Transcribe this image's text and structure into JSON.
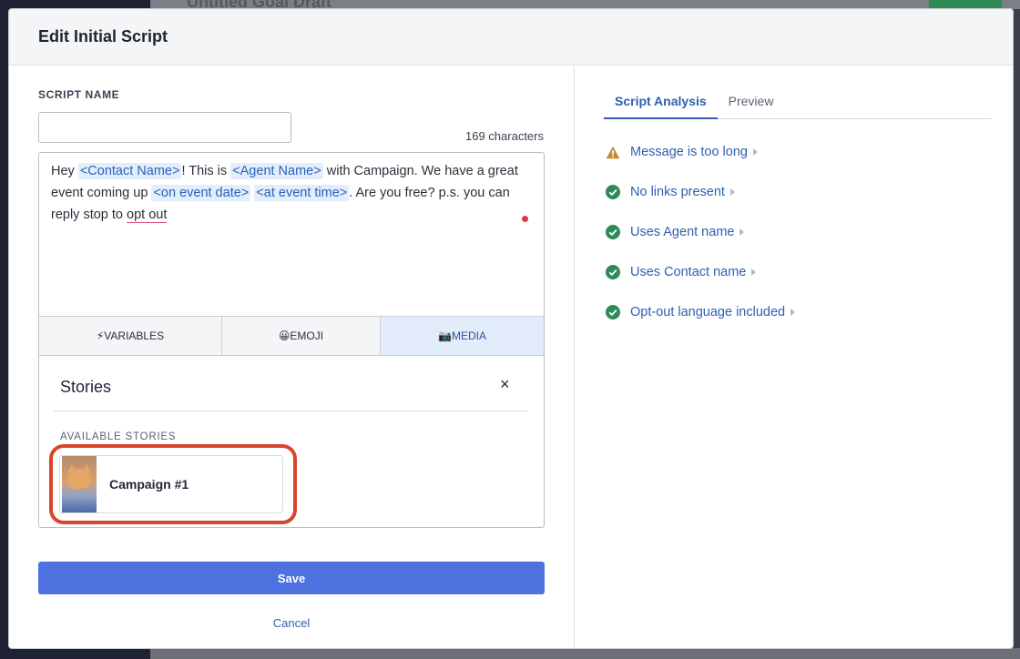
{
  "background": {
    "title": "Untitled Goal Draft"
  },
  "modal": {
    "title": "Edit Initial Script"
  },
  "script": {
    "name_label": "SCRIPT NAME",
    "name_value": "",
    "char_count": "169 characters",
    "text": {
      "p1": "Hey ",
      "t1": "<Contact Name>",
      "p2": "! This is ",
      "t2": "<Agent Name>",
      "p3": " with Campaign. We have a great event coming up ",
      "t3": "<on event date>",
      "p4": " ",
      "t4": "<at event time>",
      "p5": ". Are you free? p.s. you can reply stop to ",
      "misspelled": "opt out"
    }
  },
  "editor_tabs": {
    "variables": "⚡VARIABLES",
    "emoji": "😀EMOJI",
    "media": "📷MEDIA"
  },
  "stories": {
    "title": "Stories",
    "close": "×",
    "available_label": "AVAILABLE STORIES",
    "items": [
      {
        "name": "Campaign #1"
      }
    ]
  },
  "actions": {
    "save": "Save",
    "cancel": "Cancel"
  },
  "analysis": {
    "tabs": [
      {
        "label": "Script Analysis"
      },
      {
        "label": "Preview"
      }
    ],
    "checks": [
      {
        "label": "Message is too long",
        "status": "warning"
      },
      {
        "label": "No links present",
        "status": "pass"
      },
      {
        "label": "Uses Agent name",
        "status": "pass"
      },
      {
        "label": "Uses Contact name",
        "status": "pass"
      },
      {
        "label": "Opt-out language included",
        "status": "pass"
      }
    ]
  },
  "colors": {
    "accent": "#4d71df",
    "link": "#2e5fb0",
    "pass": "#2e8a58",
    "warning": "#c98a2e",
    "highlight": "#d8462a"
  }
}
